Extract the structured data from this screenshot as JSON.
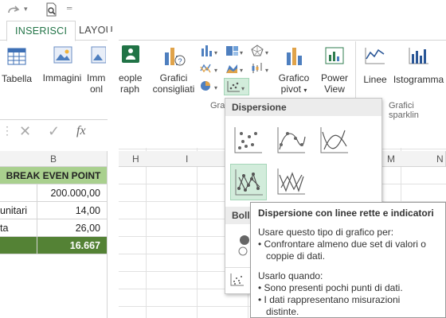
{
  "qat": {
    "redo_icon": "redo-arrow",
    "preview_icon": "print-preview",
    "more_icon": "dropdown"
  },
  "tabs": [
    {
      "label": "INSERISCI"
    },
    {
      "label": "LAYOU"
    }
  ],
  "ribbon": {
    "tabella": "Tabella",
    "immagini": "Immagini",
    "immagini_online_1": "Imm",
    "immagini_online_2": "onl",
    "people_graph_1": "eople",
    "people_graph_2": "raph",
    "grafici_consigliati_1": "Grafici",
    "grafici_consigliati_2": "consigliati",
    "grafico_pivot_1": "Grafico",
    "grafico_pivot_2": "pivot",
    "power_view_1": "Power",
    "power_view_2": "View",
    "linee": "Linee",
    "istogramma": "Istogramma",
    "group_grafici_partial": "Gra",
    "group_sparkline": "Grafici sparklin"
  },
  "formula_bar": {
    "fx": "fx"
  },
  "columns": {
    "left_B": "B",
    "H": "H",
    "I": "I",
    "M": "M",
    "N": "N"
  },
  "table": {
    "header": "BREAK EVEN POINT",
    "rows": [
      {
        "label": "",
        "value": "200.000,00"
      },
      {
        "label": "unitari",
        "value": "14,00"
      },
      {
        "label": "ta",
        "value": "26,00"
      },
      {
        "label": "",
        "value": "16.667"
      }
    ]
  },
  "gallery": {
    "title": "Dispersione",
    "bubble_title_partial": "Boll",
    "options": [
      "scatter",
      "scatter-smooth-markers",
      "scatter-smooth",
      "scatter-straight-markers",
      "scatter-straight"
    ]
  },
  "tooltip": {
    "title": "Dispersione con linee rette e indicatori",
    "intro": "Usare questo tipo di grafico per:",
    "b1": "• Confrontare almeno due set di valori o",
    "b1b": "coppie di dati.",
    "when": "Usarlo quando:",
    "b2": "• Sono presenti pochi punti di dati.",
    "b3": "• I dati rappresentano misurazioni",
    "b3b": "distinte."
  },
  "colors": {
    "accent": "#217346",
    "header_fill": "#a9d08e",
    "total_fill": "#548235",
    "selected": "#d2ecdb"
  }
}
